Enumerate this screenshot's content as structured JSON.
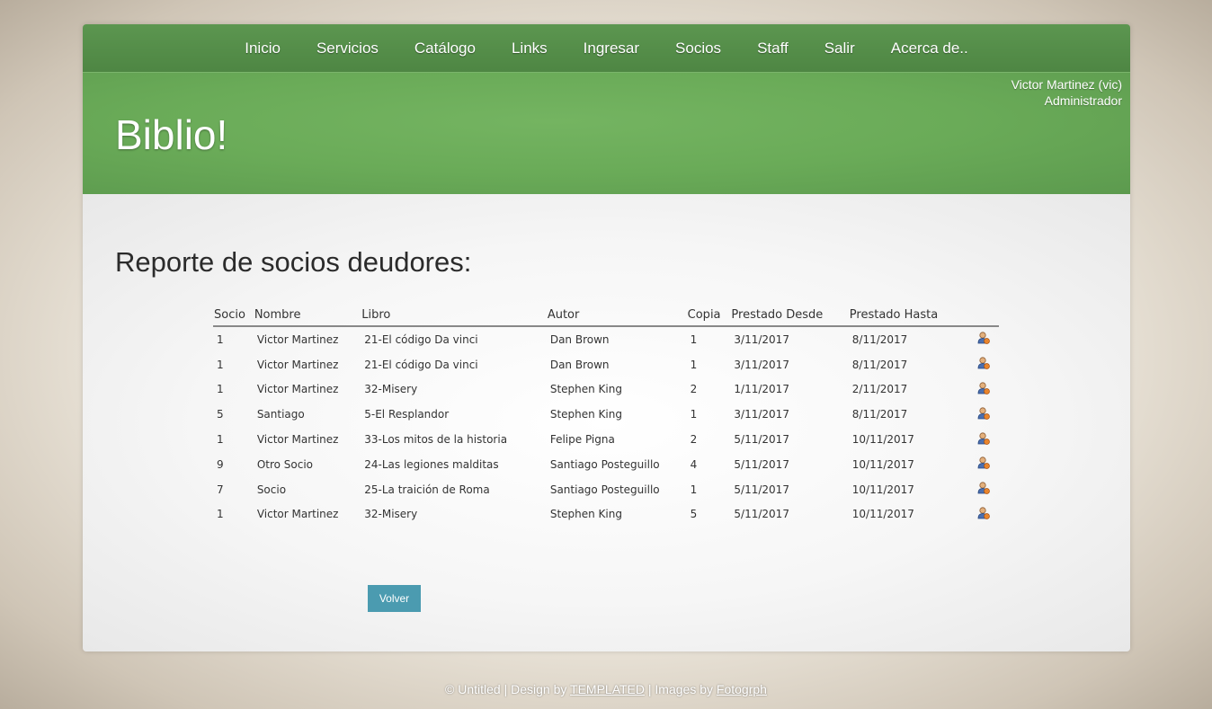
{
  "nav": {
    "items": [
      "Inicio",
      "Servicios",
      "Catálogo",
      "Links",
      "Ingresar",
      "Socios",
      "Staff",
      "Salir",
      "Acerca de.."
    ]
  },
  "header": {
    "logo": "Biblio!",
    "user_name": "Victor Martinez (vic)",
    "user_role": "Administrador"
  },
  "main": {
    "title": "Reporte de socios deudores:",
    "columns": [
      "Socio",
      "Nombre",
      "Libro",
      "Autor",
      "Copia",
      "Prestado Desde",
      "Prestado Hasta"
    ],
    "rows": [
      [
        "1",
        "Victor Martinez",
        "21-El código Da vinci",
        "Dan Brown",
        "1",
        "3/11/2017",
        "8/11/2017"
      ],
      [
        "1",
        "Victor Martinez",
        "21-El código Da vinci",
        "Dan Brown",
        "1",
        "3/11/2017",
        "8/11/2017"
      ],
      [
        "1",
        "Victor Martinez",
        "32-Misery",
        "Stephen King",
        "2",
        "1/11/2017",
        "2/11/2017"
      ],
      [
        "5",
        "Santiago",
        "5-El Resplandor",
        "Stephen King",
        "1",
        "3/11/2017",
        "8/11/2017"
      ],
      [
        "1",
        "Victor Martinez",
        "33-Los mitos de la historia",
        "Felipe Pigna",
        "2",
        "5/11/2017",
        "10/11/2017"
      ],
      [
        "9",
        "Otro Socio",
        "24-Las legiones malditas",
        "Santiago Posteguillo",
        "4",
        "5/11/2017",
        "10/11/2017"
      ],
      [
        "7",
        "Socio",
        "25-La traición de Roma",
        "Santiago Posteguillo",
        "1",
        "5/11/2017",
        "10/11/2017"
      ],
      [
        "1",
        "Victor Martinez",
        "32-Misery",
        "Stephen King",
        "5",
        "5/11/2017",
        "10/11/2017"
      ]
    ],
    "row_icon": "user-icon",
    "back_button": "Volver"
  },
  "footer": {
    "prefix": "© Untitled | Design by ",
    "design_link": "TEMPLATED",
    "middle": " | Images by ",
    "images_link": "Fotogrph"
  },
  "colors": {
    "nav_bg": "#4e8643",
    "header_bg": "#6aab58",
    "button_bg": "#4b9bb0"
  }
}
